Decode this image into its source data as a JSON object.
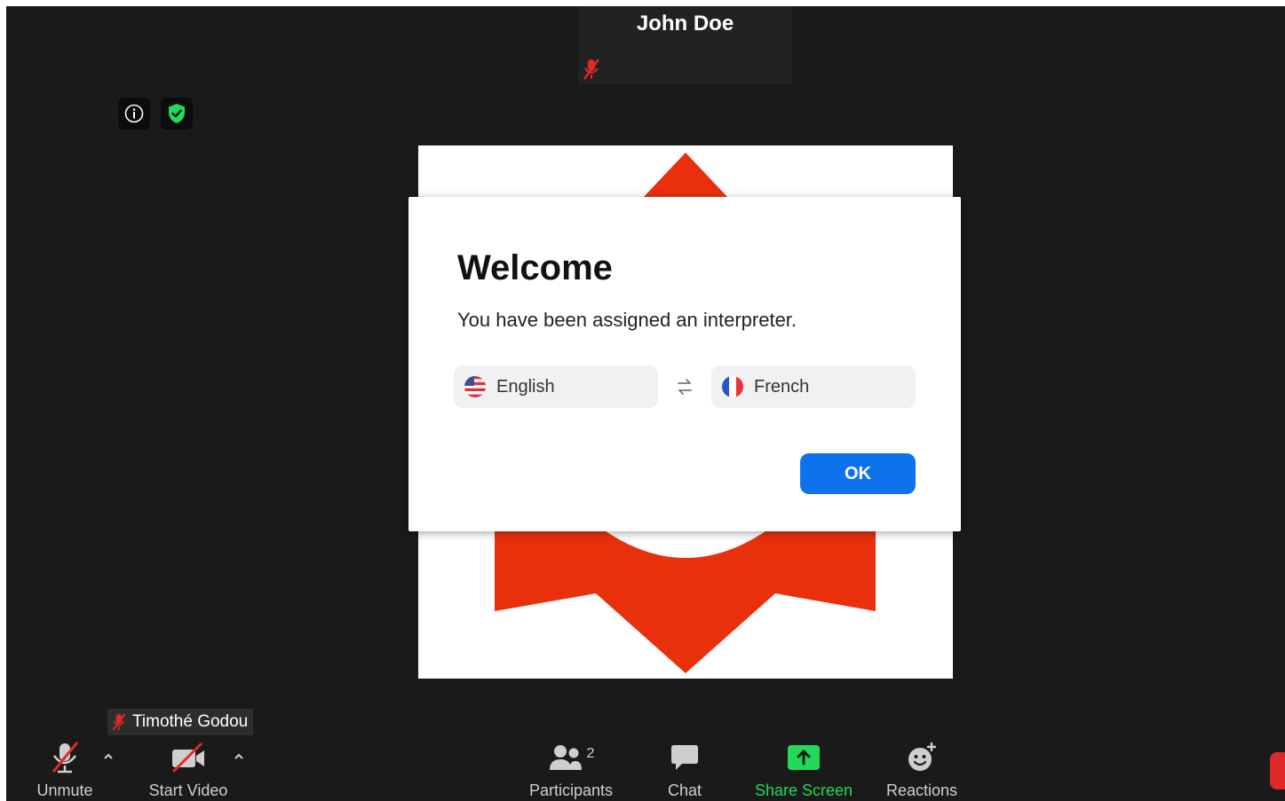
{
  "participant_tile": {
    "name": "John Doe",
    "muted": true
  },
  "meeting_info": {
    "info_icon": "info-icon",
    "shield_icon": "shield-check-icon",
    "shield_color": "#23d959"
  },
  "dialog": {
    "title": "Welcome",
    "message": "You have been assigned an interpreter.",
    "from_language": "English",
    "to_language": "French",
    "ok_label": "OK",
    "accent_color": "#0e72ed"
  },
  "self_view": {
    "name": "Timothé Godou",
    "muted": true
  },
  "toolbar": {
    "unmute_label": "Unmute",
    "start_video_label": "Start Video",
    "participants_label": "Participants",
    "participants_count": "2",
    "chat_label": "Chat",
    "share_label": "Share Screen",
    "reactions_label": "Reactions",
    "share_color": "#23d959",
    "muted_color": "#e02828"
  },
  "shared_content": {
    "logo_color": "#e8300c"
  }
}
